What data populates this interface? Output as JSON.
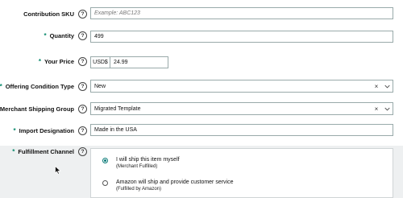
{
  "fields": {
    "sku": {
      "label": "Contribution SKU",
      "placeholder": "Example: ABC123",
      "required": false
    },
    "quantity": {
      "label": "Quantity",
      "value": "499",
      "required": true
    },
    "price": {
      "label": "Your Price",
      "currency": "USD$",
      "value": "24.99",
      "required": true
    },
    "condition": {
      "label": "Offering Condition Type",
      "value": "New",
      "required": true
    },
    "shipping_group": {
      "label": "Merchant Shipping Group",
      "value": "Migrated Template",
      "required": true
    },
    "import_designation": {
      "label": "Import Designation",
      "value": "Made in the USA",
      "required": true
    },
    "fulfillment": {
      "label": "Fulfillment Channel",
      "required": true,
      "options": [
        {
          "title": "I will ship this item myself",
          "subtitle": "(Merchant Fulfilled)",
          "selected": true
        },
        {
          "title": "Amazon will ship and provide customer service",
          "subtitle": "(Fulfilled by Amazon)",
          "selected": false
        }
      ]
    }
  },
  "icons": {
    "help": "?",
    "clear": "×"
  },
  "colors": {
    "required_asterisk": "#0b8a6d",
    "radio_selected": "#0a7a78"
  }
}
